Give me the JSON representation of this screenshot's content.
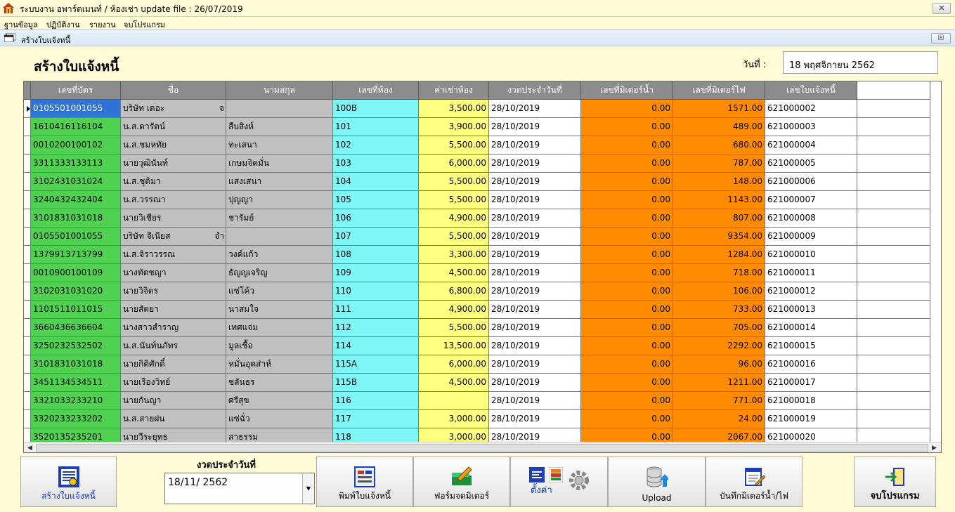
{
  "window": {
    "title": "ระบบงาน อพาร์ตเมนท์ / ห้องเช่า update file : 26/07/2019",
    "close": "✕"
  },
  "menu": [
    "ฐานข้อมูล",
    "ปฏิบัติงาน",
    "รายงาน",
    "จบโปรแกรม"
  ],
  "child": {
    "title": "สร้างใบแจ้งหนี้",
    "close": "☒"
  },
  "page": {
    "heading": "สร้างใบแจ้งหนี้",
    "date_label": "วันที่ :",
    "date_value": "18 พฤศจิกายน 2562"
  },
  "table": {
    "columns": [
      "เลขที่บัตร",
      "ชื่อ",
      "นามสกุล",
      "เลขที่ห้อง",
      "ค่าเช่าห้อง",
      "งวดประจำวันที่",
      "เลขที่มิเตอร์น้ำ",
      "เลขที่มิเตอร์ไฟ",
      "เลขใบแจ้งหนี้"
    ],
    "rows": [
      [
        "0105501001055",
        "บริษัท เดอะ",
        "จ",
        "",
        "100B",
        "3,500.00",
        "28/10/2019",
        "0.00",
        "1571.00",
        "621000002"
      ],
      [
        "1610416116104",
        "น.ส.ดารัตน์",
        "",
        "สืบสิงห์",
        "101",
        "3,900.00",
        "28/10/2019",
        "0.00",
        "489.00",
        "621000003"
      ],
      [
        "0010200100102",
        "น.ส.ชมหทัย",
        "",
        "ทะเสนา",
        "102",
        "5,500.00",
        "28/10/2019",
        "0.00",
        "680.00",
        "621000004"
      ],
      [
        "3311333133113",
        "นายวุฒินันท์",
        "",
        "เกษมจิตมั่น",
        "103",
        "6,000.00",
        "28/10/2019",
        "0.00",
        "787.00",
        "621000005"
      ],
      [
        "3102431031024",
        "น.ส.ชุติมา",
        "",
        "แสงเสนา",
        "104",
        "5,500.00",
        "28/10/2019",
        "0.00",
        "148.00",
        "621000006"
      ],
      [
        "3240432432404",
        "น.ส.วรรณา",
        "",
        "ปุญญา",
        "105",
        "5,500.00",
        "28/10/2019",
        "0.00",
        "1143.00",
        "621000007"
      ],
      [
        "3101831031018",
        "นายวิเชียร",
        "",
        "ชารัมย์",
        "106",
        "4,900.00",
        "28/10/2019",
        "0.00",
        "807.00",
        "621000008"
      ],
      [
        "0105501001055",
        "บริษัท จีเนียส",
        "จำ",
        "",
        "107",
        "5,500.00",
        "28/10/2019",
        "0.00",
        "9354.00",
        "621000009"
      ],
      [
        "1379913713799",
        "น.ส.จิราวรรณ",
        "",
        "วงค์แก้ว",
        "108",
        "3,300.00",
        "28/10/2019",
        "0.00",
        "1284.00",
        "621000010"
      ],
      [
        "0010900100109",
        "นางทัตชญา",
        "",
        "ธัญญเจริญ",
        "109",
        "4,500.00",
        "28/10/2019",
        "0.00",
        "718.00",
        "621000011"
      ],
      [
        "3102031031020",
        "นายวิจิตร",
        "",
        "แซ่โค้ว",
        "110",
        "6,800.00",
        "28/10/2019",
        "0.00",
        "106.00",
        "621000012"
      ],
      [
        "1101511011015",
        "นายสัตยา",
        "",
        "นาสมใจ",
        "111",
        "4,900.00",
        "28/10/2019",
        "0.00",
        "733.00",
        "621000013"
      ],
      [
        "3660436636604",
        "นางสาวสำราญ",
        "",
        "เทศแจ่ม",
        "112",
        "5,500.00",
        "28/10/2019",
        "0.00",
        "705.00",
        "621000014"
      ],
      [
        "3250232532502",
        "น.ส.นันท์นภัทร",
        "",
        "มูลเชื้อ",
        "114",
        "13,500.00",
        "28/10/2019",
        "0.00",
        "2292.00",
        "621000015"
      ],
      [
        "3101831031018",
        "นายกิติศักดิ์",
        "",
        "หมั่นอุตส่าห์",
        "115A",
        "6,000.00",
        "28/10/2019",
        "0.00",
        "96.00",
        "621000016"
      ],
      [
        "3451134534511",
        "นายเรืองวิทย์",
        "",
        "ชลันธร",
        "115B",
        "4,500.00",
        "28/10/2019",
        "0.00",
        "1211.00",
        "621000017"
      ],
      [
        "3321033233210",
        "นายกันญา",
        "",
        "ศรีสุข",
        "116",
        "",
        "28/10/2019",
        "0.00",
        "771.00",
        "621000018"
      ],
      [
        "3320233233202",
        "น.ส.สายฝน",
        "",
        "แซ่ฉั่ว",
        "117",
        "3,000.00",
        "28/10/2019",
        "0.00",
        "24.00",
        "621000019"
      ],
      [
        "3520135235201",
        "นายวีระยุทธ",
        "",
        "สาธรรม",
        "118",
        "3,000.00",
        "28/10/2019",
        "0.00",
        "2067.00",
        "621000020"
      ]
    ]
  },
  "toolbar": {
    "create_label": "สร้างใบแจ้งหนี้",
    "period_label": "งวดประจำวันที่",
    "period_value": "18/11/ 2562",
    "print_label": "พิมพ์ใบแจ้งหนี้",
    "meter_form_label": "ฟอร์มจดมิเตอร์",
    "settings_label": "ตั้งค่า",
    "upload_label": "Upload",
    "record_meter_label": "บันทึกมิเตอร์น้ำ/ไฟ",
    "exit_label": "จบโปรแกรม"
  },
  "colors": {
    "id": "#51d151",
    "name": "#c0c0c0",
    "room": "#7ff7f7",
    "rent": "#ffff80",
    "meter": "#ff8c00",
    "header": "#8c8c8c",
    "selected": "#2f73d6",
    "background": "#fffbd6"
  }
}
